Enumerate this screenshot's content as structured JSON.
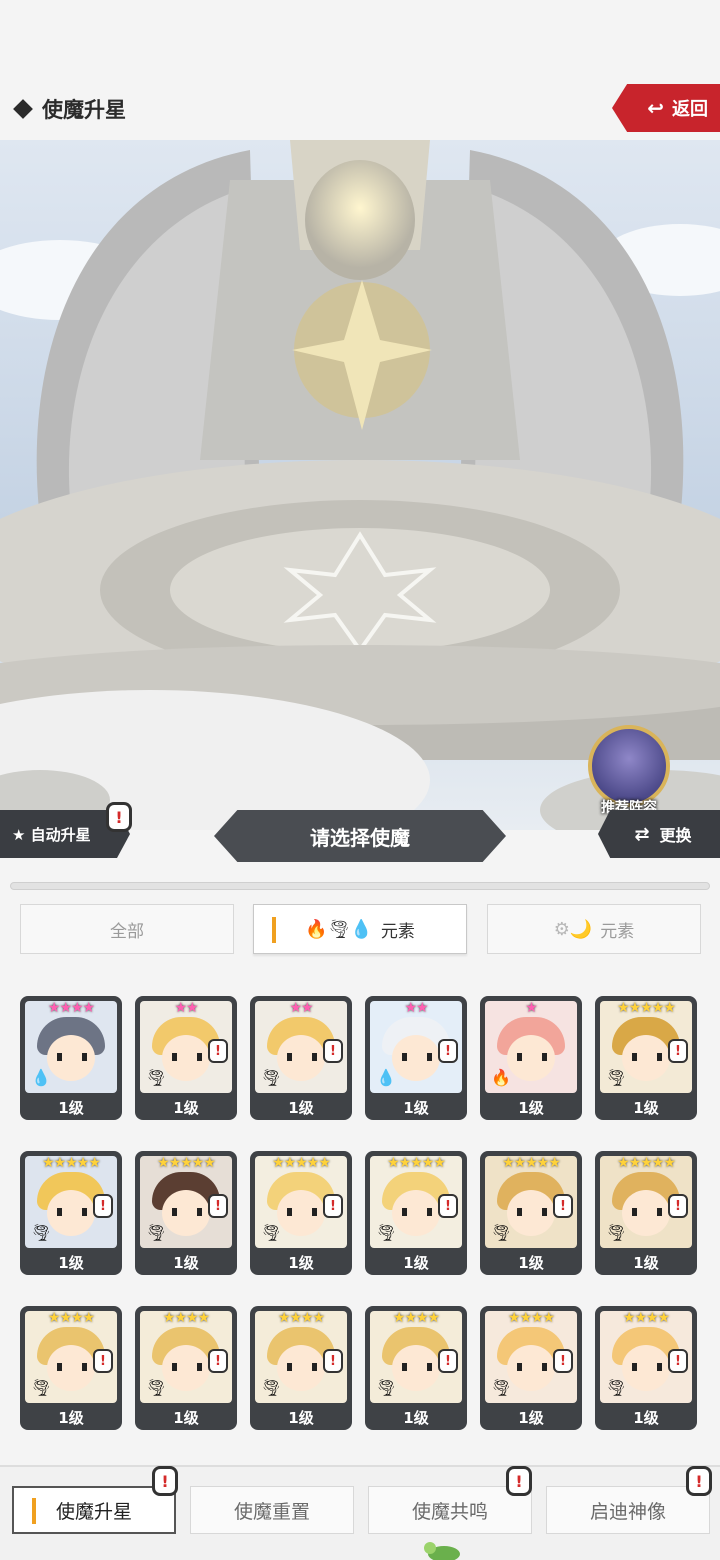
{
  "header": {
    "title": "使魔升星",
    "back_label": "返回",
    "back_icon": "↩"
  },
  "scene": {
    "recommend_label": "推荐阵容"
  },
  "controls": {
    "auto_label": "★ 自动升星",
    "select_prompt": "请选择使魔",
    "swap_label": "更换",
    "swap_icon": "⇄",
    "alert_mark": "!"
  },
  "filters": [
    {
      "label": "全部",
      "icons": "",
      "active": false
    },
    {
      "label": "元素",
      "icons": "🔥🌪💧",
      "active": true
    },
    {
      "label": "元素",
      "icons": "⚙🌙",
      "active": false
    }
  ],
  "cards": [
    {
      "stars": "★★★★",
      "star_color": "#ff5fb2",
      "level": "1级",
      "element": "💧",
      "alert": false,
      "bg": "#dfe6f0",
      "hair": "#6d7485"
    },
    {
      "stars": "★★",
      "star_color": "#ff5fb2",
      "level": "1级",
      "element": "🌪",
      "alert": true,
      "bg": "#f0ece4",
      "hair": "#f2c96b"
    },
    {
      "stars": "★★",
      "star_color": "#ff5fb2",
      "level": "1级",
      "element": "🌪",
      "alert": true,
      "bg": "#f0ece4",
      "hair": "#f2c96b"
    },
    {
      "stars": "★★",
      "star_color": "#ff5fb2",
      "level": "1级",
      "element": "💧",
      "alert": true,
      "bg": "#e4eef8",
      "hair": "#eef1f5"
    },
    {
      "stars": "★",
      "star_color": "#ff5fb2",
      "level": "1级",
      "element": "🔥",
      "alert": false,
      "bg": "#f6e3e1",
      "hair": "#f2a59a"
    },
    {
      "stars": "★★★★★",
      "star_color": "#ffd23a",
      "level": "1级",
      "element": "🌪",
      "alert": true,
      "bg": "#f3ead6",
      "hair": "#d9a847"
    },
    {
      "stars": "★★★★★",
      "star_color": "#ffd23a",
      "level": "1级",
      "element": "🌪",
      "alert": true,
      "bg": "#dde4ee",
      "hair": "#f1c75a"
    },
    {
      "stars": "★★★★★",
      "star_color": "#ffd23a",
      "level": "1级",
      "element": "🌪",
      "alert": true,
      "bg": "#e6ded6",
      "hair": "#5b3e32"
    },
    {
      "stars": "★★★★★",
      "star_color": "#ffd23a",
      "level": "1级",
      "element": "🌪",
      "alert": true,
      "bg": "#f3eee0",
      "hair": "#f3d27a"
    },
    {
      "stars": "★★★★★",
      "star_color": "#ffd23a",
      "level": "1级",
      "element": "🌪",
      "alert": true,
      "bg": "#f3eee0",
      "hair": "#f3d27a"
    },
    {
      "stars": "★★★★★",
      "star_color": "#ffd23a",
      "level": "1级",
      "element": "🌪",
      "alert": true,
      "bg": "#efe2c7",
      "hair": "#e0b25e"
    },
    {
      "stars": "★★★★★",
      "star_color": "#ffd23a",
      "level": "1级",
      "element": "🌪",
      "alert": true,
      "bg": "#efe2c7",
      "hair": "#e0b25e"
    },
    {
      "stars": "★★★★",
      "star_color": "#ffd23a",
      "level": "1级",
      "element": "🌪",
      "alert": true,
      "bg": "#f4ecd9",
      "hair": "#eac46e"
    },
    {
      "stars": "★★★★",
      "star_color": "#ffd23a",
      "level": "1级",
      "element": "🌪",
      "alert": true,
      "bg": "#f4ecd9",
      "hair": "#eac46e"
    },
    {
      "stars": "★★★★",
      "star_color": "#ffd23a",
      "level": "1级",
      "element": "🌪",
      "alert": true,
      "bg": "#f4ecd9",
      "hair": "#eac46e"
    },
    {
      "stars": "★★★★",
      "star_color": "#ffd23a",
      "level": "1级",
      "element": "🌪",
      "alert": true,
      "bg": "#f4ecd9",
      "hair": "#eac46e"
    },
    {
      "stars": "★★★★",
      "star_color": "#ffd23a",
      "level": "1级",
      "element": "🌪",
      "alert": true,
      "bg": "#f6e9dc",
      "hair": "#f4c777"
    },
    {
      "stars": "★★★★",
      "star_color": "#ffd23a",
      "level": "1级",
      "element": "🌪",
      "alert": true,
      "bg": "#f6e9dc",
      "hair": "#f4c777"
    }
  ],
  "bottom_nav": [
    {
      "label": "使魔升星",
      "active": true,
      "alert": true
    },
    {
      "label": "使魔重置",
      "active": false,
      "alert": false
    },
    {
      "label": "使魔共鸣",
      "active": false,
      "alert": true
    },
    {
      "label": "启迪神像",
      "active": false,
      "alert": true
    }
  ]
}
